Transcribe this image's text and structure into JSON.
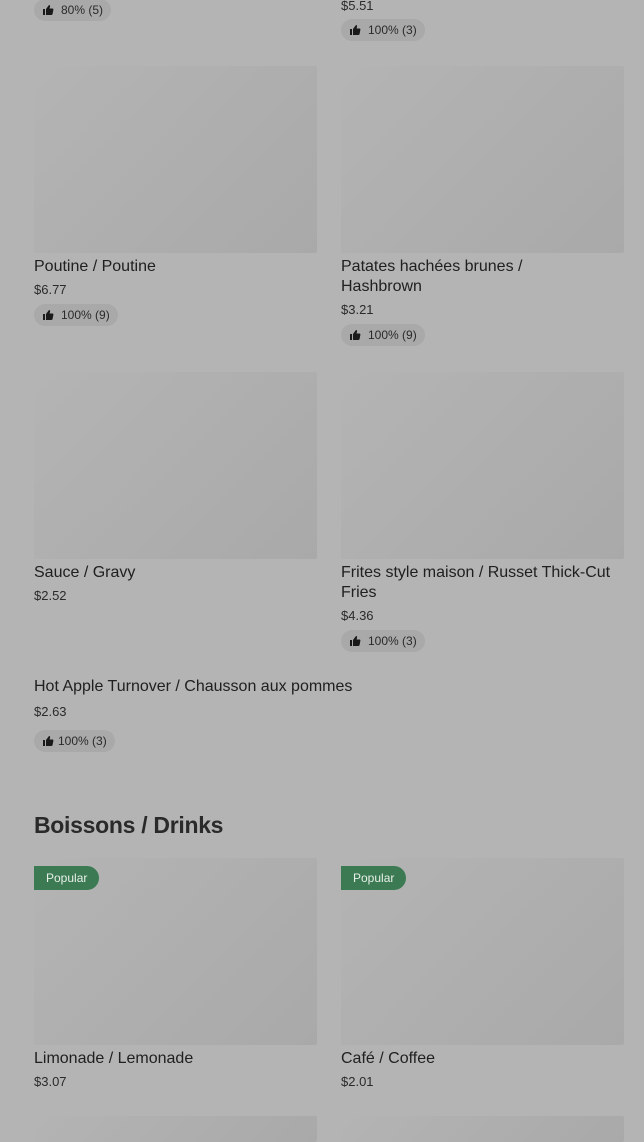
{
  "items": {
    "top_left_rating": "80% (5)",
    "top_right_price": "$5.51",
    "top_right_rating": "100% (3)",
    "poutine_name": "Poutine / Poutine",
    "poutine_price": "$6.77",
    "poutine_rating": "100% (9)",
    "hashbrown_name": "Patates hachées brunes / Hashbrown",
    "hashbrown_price": "$3.21",
    "hashbrown_rating": "100% (9)",
    "gravy_name": "Sauce / Gravy",
    "gravy_price": "$2.52",
    "fries_name": "Frites style maison / Russet Thick-Cut Fries",
    "fries_price": "$4.36",
    "fries_rating": "100% (3)",
    "turnover_name": "Hot Apple Turnover / Chausson aux pommes",
    "turnover_price": "$2.63",
    "turnover_rating": "100% (3)"
  },
  "drinks": {
    "section_title": "Boissons / Drinks",
    "badge_label": "Popular",
    "lemonade_name": "Limonade / Lemonade",
    "lemonade_price": "$3.07",
    "coffee_name": "Café / Coffee",
    "coffee_price": "$2.01"
  },
  "icons": {
    "rating": "thumbs-up-icon"
  }
}
